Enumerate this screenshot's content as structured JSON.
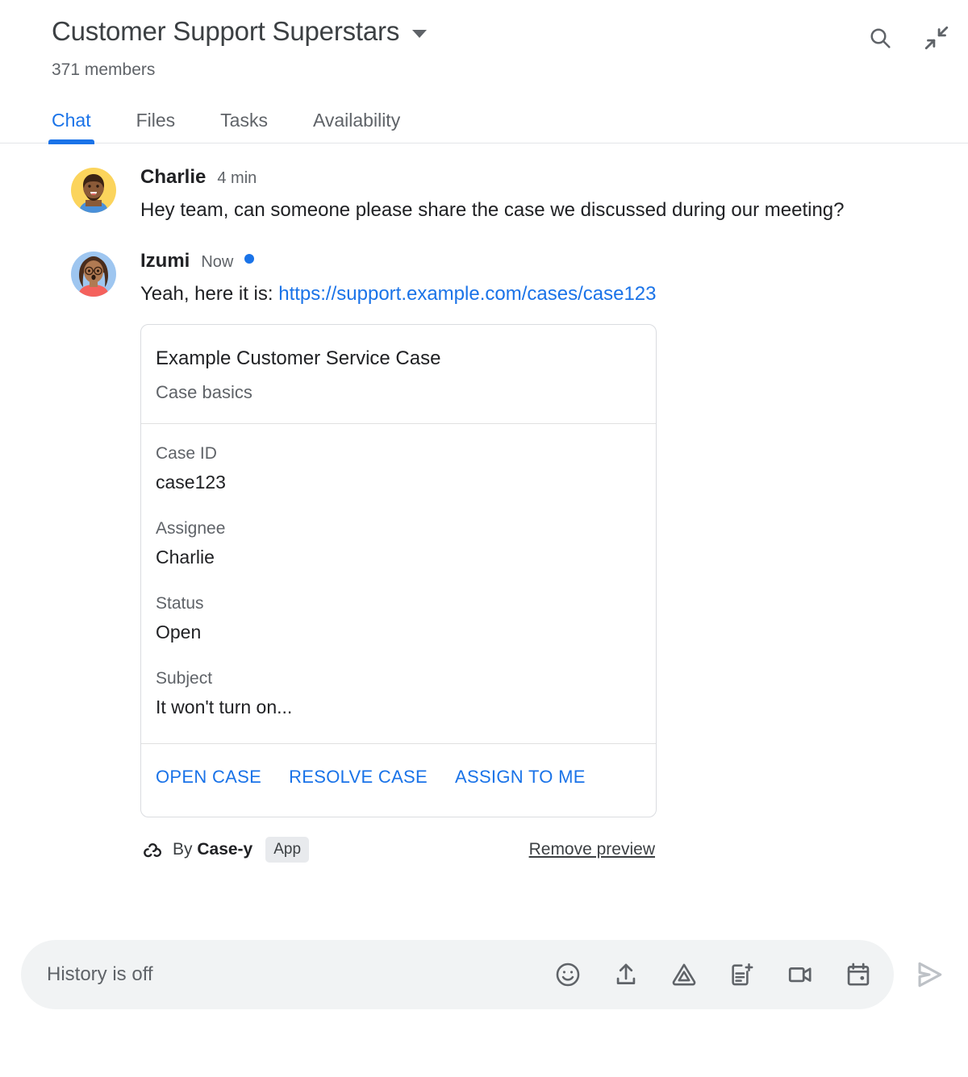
{
  "header": {
    "room_title": "Customer Support Superstars",
    "member_count": "371 members",
    "dropdown_icon": "chevron-down-icon",
    "search_icon": "search-icon",
    "collapse_icon": "collapse-arrows-icon"
  },
  "tabs": [
    {
      "label": "Chat",
      "active": true
    },
    {
      "label": "Files",
      "active": false
    },
    {
      "label": "Tasks",
      "active": false
    },
    {
      "label": "Availability",
      "active": false
    }
  ],
  "messages": [
    {
      "sender": "Charlie",
      "timestamp": "4 min",
      "unread": false,
      "text": "Hey team, can someone please share the case we discussed during our meeting?",
      "avatar": "charlie-avatar"
    },
    {
      "sender": "Izumi",
      "timestamp": "Now",
      "unread": true,
      "text_prefix": "Yeah, here it is: ",
      "link_text": "https://support.example.com/cases/case123",
      "avatar": "izumi-avatar"
    }
  ],
  "card": {
    "title": "Example Customer Service Case",
    "subtitle": "Case basics",
    "fields": [
      {
        "label": "Case ID",
        "value": "case123"
      },
      {
        "label": "Assignee",
        "value": "Charlie"
      },
      {
        "label": "Status",
        "value": "Open"
      },
      {
        "label": "Subject",
        "value": "It won't turn on..."
      }
    ],
    "actions": [
      {
        "label": "OPEN CASE"
      },
      {
        "label": "RESOLVE CASE"
      },
      {
        "label": "ASSIGN TO ME"
      }
    ],
    "footer": {
      "app_icon": "webhook-icon",
      "by_prefix": "By ",
      "app_name": "Case-y",
      "app_badge": "App",
      "remove_preview": "Remove preview"
    }
  },
  "composer": {
    "placeholder": "History is off",
    "icons": [
      {
        "name": "emoji-icon"
      },
      {
        "name": "upload-icon"
      },
      {
        "name": "google-drive-icon"
      },
      {
        "name": "new-task-icon"
      },
      {
        "name": "video-meeting-icon"
      },
      {
        "name": "calendar-icon"
      }
    ],
    "send_icon": "send-icon"
  },
  "colors": {
    "accent": "#1a73e8",
    "text_primary": "#202124",
    "text_secondary": "#5f6368",
    "border": "#dadce0",
    "composer_bg": "#f1f3f4"
  }
}
